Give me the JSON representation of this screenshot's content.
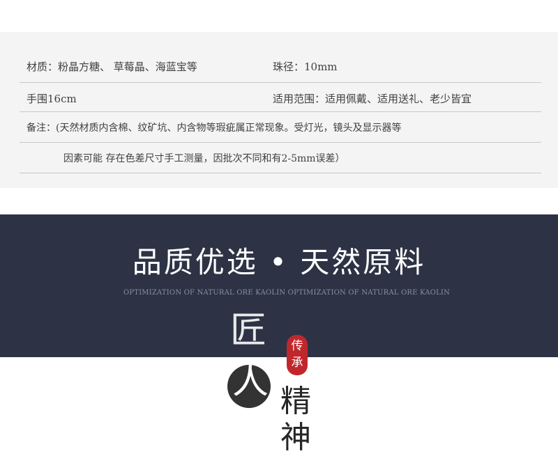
{
  "specs": {
    "material": "材质：粉晶方糖、 草莓晶、海蓝宝等",
    "diameter": "珠径：10mm",
    "wrist": "手围16cm",
    "usage": "适用范围：适用佩戴、适用送礼、老少皆宜",
    "note_line1": "备注：(天然材质内含棉、纹矿坑、内含物等瑕疵属正常现象。受灯光，镜头及显示器等",
    "note_line2": "因素可能  存在色差尺寸手工测量，因批次不同和有2-5mm误差）"
  },
  "banner": {
    "title": "品质优选 • 天然原料",
    "subtitle": "OPTIMIZATION OF NATURAL ORE KAOLIN OPTIMIZATION OF NATURAL ORE KAOLIN"
  },
  "craft": {
    "jiang": "匠",
    "ren": "人",
    "seal_line1": "传",
    "seal_line2": "承",
    "jing": "精",
    "shen": "神"
  },
  "colors": {
    "banner_bg": "#2d3345",
    "seal_red": "#c0272d",
    "panel_bg": "#f4f4f4"
  }
}
